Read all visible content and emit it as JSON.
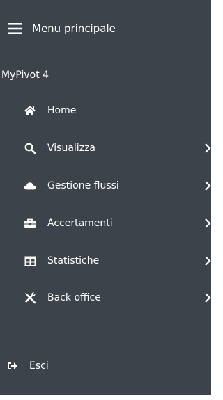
{
  "sidebar": {
    "menu_label": "Menu principale",
    "app_title": "MyPivot 4",
    "items": [
      {
        "label": "Home",
        "icon": "home-icon",
        "has_submenu": false
      },
      {
        "label": "Visualizza",
        "icon": "search-icon",
        "has_submenu": true
      },
      {
        "label": "Gestione flussi",
        "icon": "cloud-icon",
        "has_submenu": true
      },
      {
        "label": "Accertamenti",
        "icon": "briefcase-icon",
        "has_submenu": true
      },
      {
        "label": "Statistiche",
        "icon": "table-icon",
        "has_submenu": true
      },
      {
        "label": "Back office",
        "icon": "tools-icon",
        "has_submenu": true
      }
    ],
    "logout_label": "Esci"
  },
  "colors": {
    "sidebar_bg": "#3d434a",
    "text": "#ffffff"
  }
}
